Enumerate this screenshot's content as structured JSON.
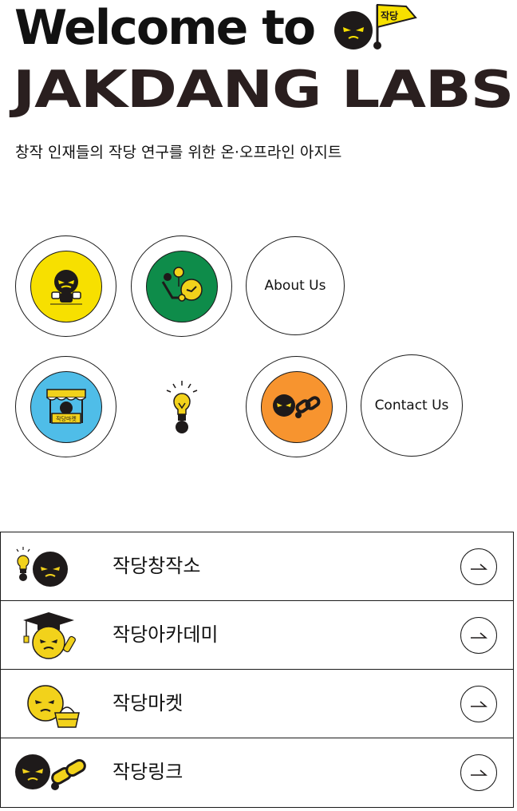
{
  "hero": {
    "title_line1": "Welcome to",
    "title_line2": "JAKDANG LABS",
    "flag_text": "작당",
    "tagline": "창작 인재들의 작당 연구를 위한 온·오프라인 아지트"
  },
  "grid": {
    "about_label": "About Us",
    "contact_label": "Contact Us",
    "market_sign": "작당마켓"
  },
  "menu": {
    "items": [
      {
        "label": "작당창작소"
      },
      {
        "label": "작당아카데미"
      },
      {
        "label": "작당마켓"
      },
      {
        "label": "작당링크"
      }
    ]
  },
  "colors": {
    "ink": "#1e1a1a",
    "yellow": "#f7e000",
    "green": "#0e8c4a",
    "sky": "#4fbde8",
    "orange": "#f7942f",
    "face_yellow": "#f2d21b"
  },
  "icons": [
    "mascot-face-icon",
    "flag-icon",
    "lightbulb-icon",
    "graduation-cap-icon",
    "basket-icon",
    "chain-link-icon",
    "arrow-right-icon"
  ]
}
